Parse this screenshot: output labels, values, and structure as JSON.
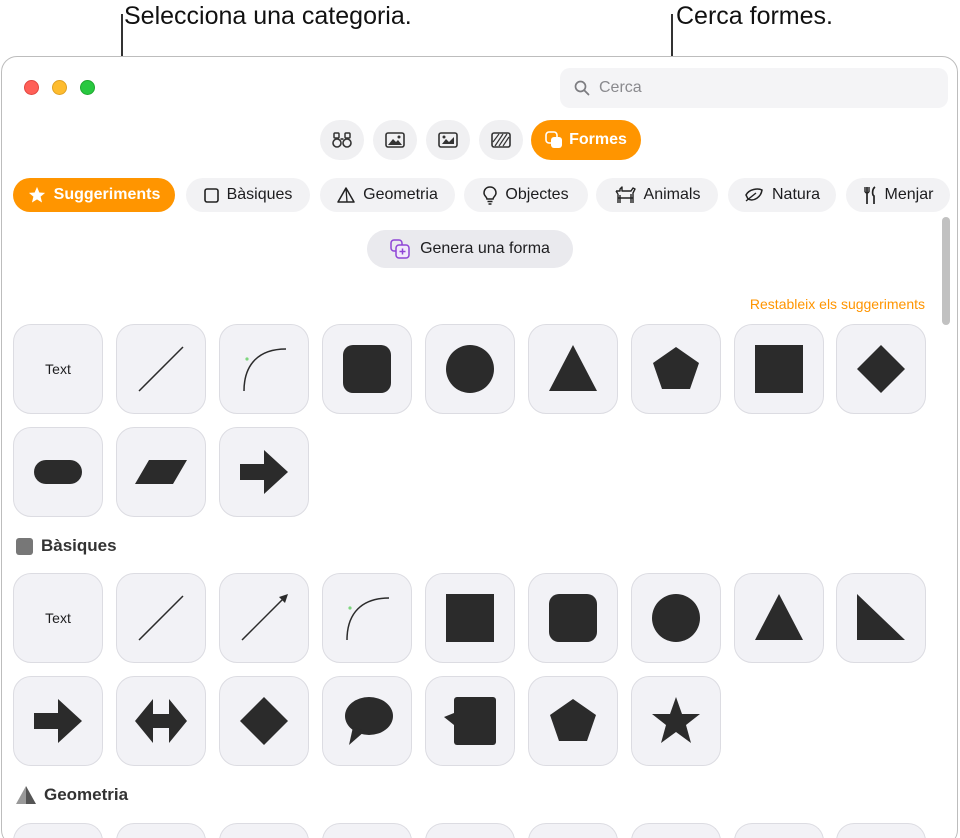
{
  "callouts": {
    "categories": "Selecciona una categoria.",
    "search": "Cerca formes."
  },
  "window": {
    "search": {
      "placeholder": "Cerca"
    },
    "type_buttons": [
      {
        "icon": "binoculars-icon"
      },
      {
        "icon": "image-icon"
      },
      {
        "icon": "media-icon"
      },
      {
        "icon": "pattern-icon"
      },
      {
        "icon": "shapes-icon",
        "label": "Formes",
        "active": true
      }
    ],
    "categories": [
      {
        "label": "Suggeriments",
        "icon": "star-icon",
        "active": true
      },
      {
        "label": "Bàsiques",
        "icon": "square-icon"
      },
      {
        "label": "Geometria",
        "icon": "pyramid-icon"
      },
      {
        "label": "Objectes",
        "icon": "lightbulb-icon"
      },
      {
        "label": "Animals",
        "icon": "dog-icon"
      },
      {
        "label": "Natura",
        "icon": "leaf-icon"
      },
      {
        "label": "Menjar",
        "icon": "fork-knife-icon"
      }
    ],
    "generate_button": "Genera una forma",
    "reset_link": "Restableix els suggeriments",
    "suggestions": [
      {
        "shape": "text",
        "label": "Text"
      },
      {
        "shape": "line"
      },
      {
        "shape": "curve"
      },
      {
        "shape": "rounded-square"
      },
      {
        "shape": "circle"
      },
      {
        "shape": "triangle"
      },
      {
        "shape": "pentagon"
      },
      {
        "shape": "square"
      },
      {
        "shape": "diamond"
      },
      {
        "shape": "pill"
      },
      {
        "shape": "parallelogram"
      },
      {
        "shape": "arrow"
      }
    ],
    "sections": [
      {
        "title": "Bàsiques",
        "icon": "square-icon",
        "shapes": [
          {
            "shape": "text",
            "label": "Text"
          },
          {
            "shape": "line"
          },
          {
            "shape": "arrow-line"
          },
          {
            "shape": "curve"
          },
          {
            "shape": "square"
          },
          {
            "shape": "rounded-square"
          },
          {
            "shape": "circle"
          },
          {
            "shape": "triangle"
          },
          {
            "shape": "right-triangle"
          },
          {
            "shape": "arrow"
          },
          {
            "shape": "double-arrow"
          },
          {
            "shape": "diamond"
          },
          {
            "shape": "speech-bubble"
          },
          {
            "shape": "callout-square"
          },
          {
            "shape": "pentagon"
          },
          {
            "shape": "star"
          }
        ]
      },
      {
        "title": "Geometria",
        "icon": "pyramid-icon"
      }
    ],
    "colors": {
      "accent": "#ff9500",
      "shape_fill": "#2b2b2b",
      "tile_bg": "#f2f2f6"
    }
  }
}
